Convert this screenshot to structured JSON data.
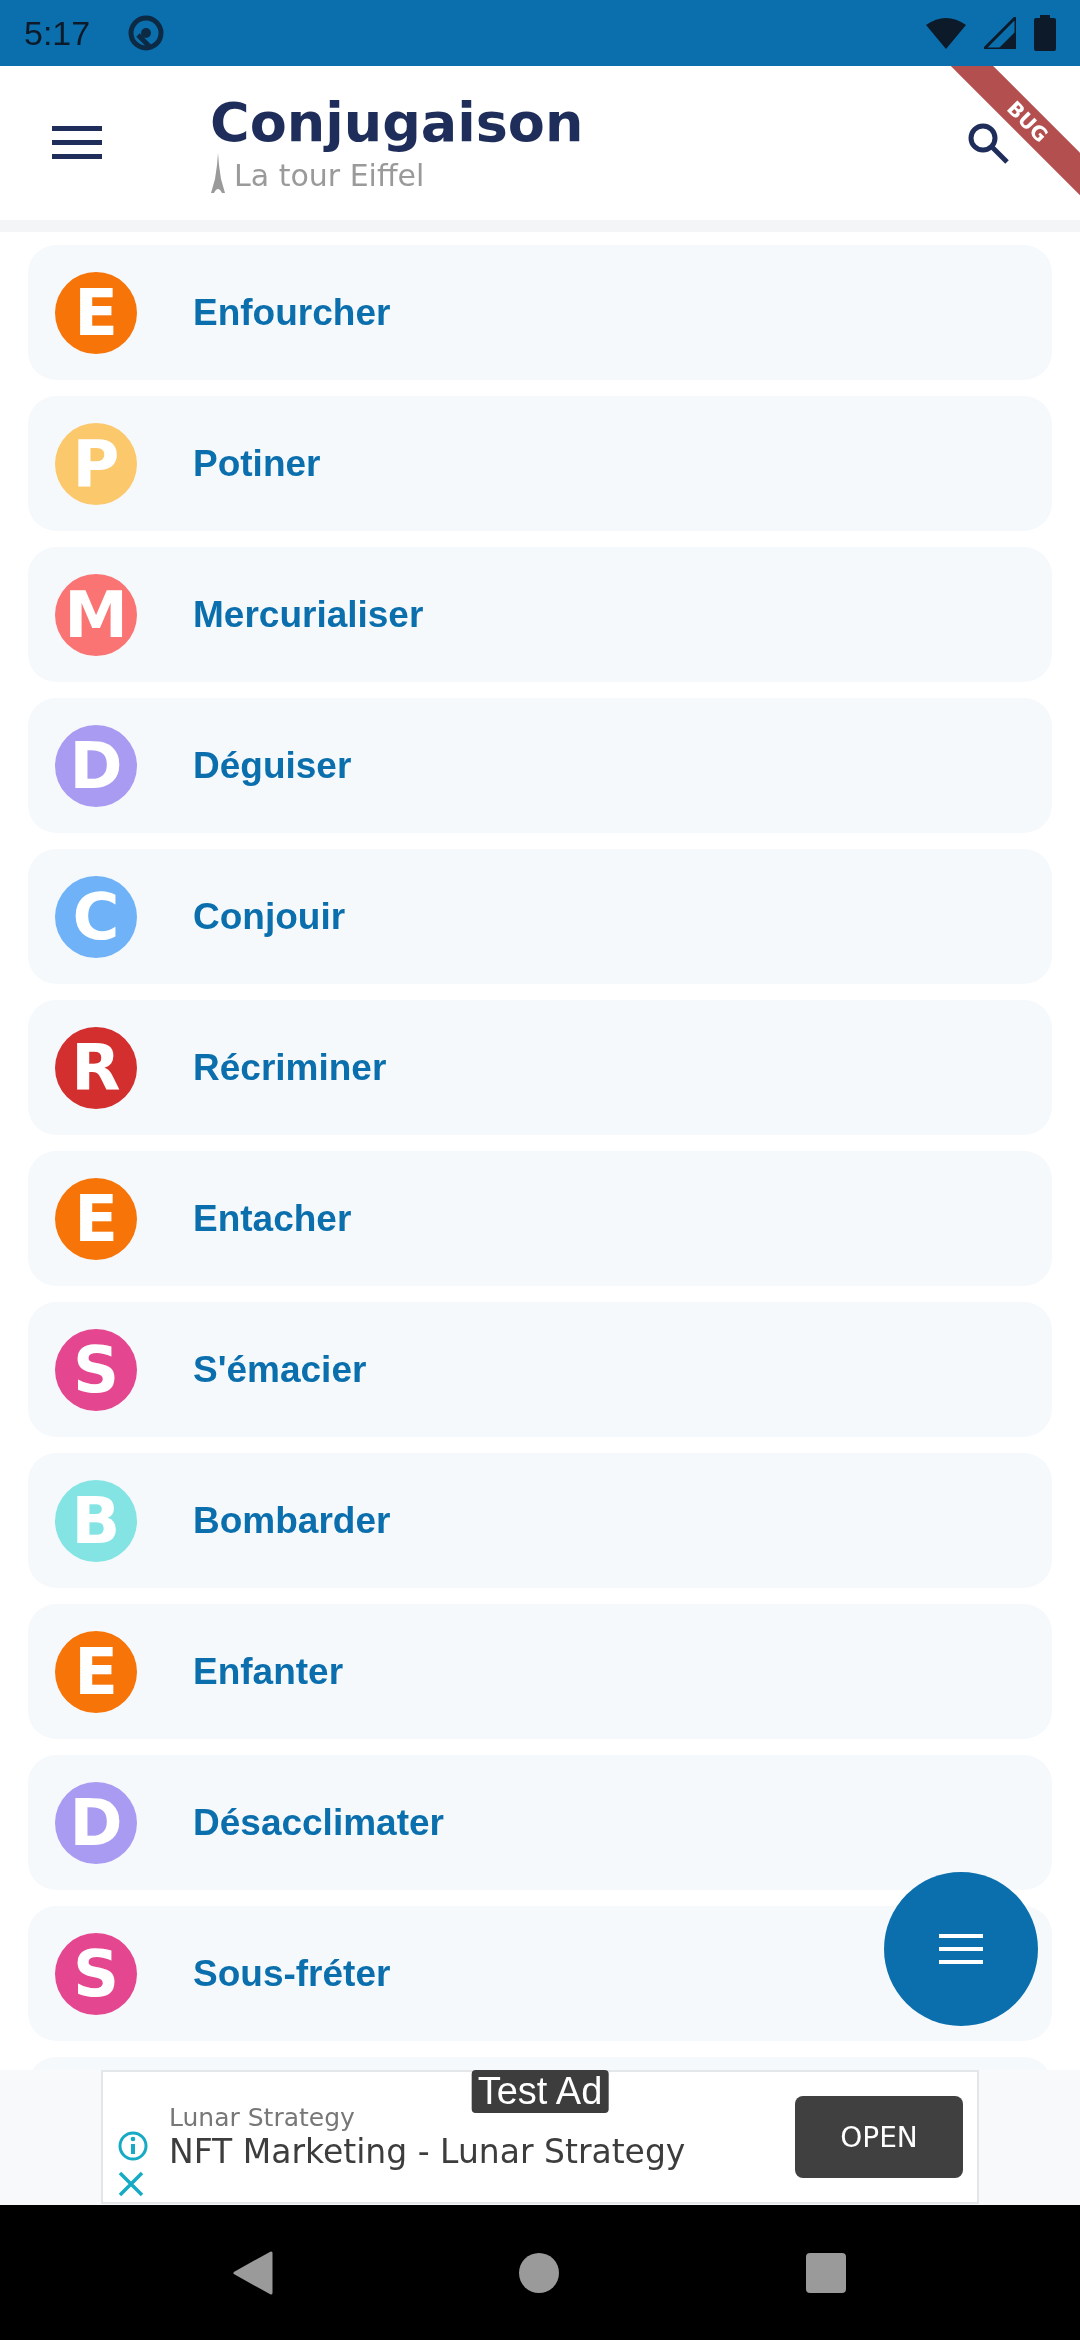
{
  "status_bar": {
    "time": "5:17"
  },
  "app_bar": {
    "title": "Conjugaison",
    "subtitle": "La tour Eiffel",
    "debug_banner": "BUG"
  },
  "verbs": [
    {
      "letter": "E",
      "name": "Enfourcher",
      "color": "#f77408"
    },
    {
      "letter": "P",
      "name": "Potiner",
      "color": "#fbc86c"
    },
    {
      "letter": "M",
      "name": "Mercurialiser",
      "color": "#fa7474"
    },
    {
      "letter": "D",
      "name": "Déguiser",
      "color": "#a99af2"
    },
    {
      "letter": "C",
      "name": "Conjouir",
      "color": "#6fb2f7"
    },
    {
      "letter": "R",
      "name": "Récriminer",
      "color": "#d32f2f"
    },
    {
      "letter": "E",
      "name": "Entacher",
      "color": "#f77408"
    },
    {
      "letter": "S",
      "name": "S'émacier",
      "color": "#e4478f"
    },
    {
      "letter": "B",
      "name": "Bombarder",
      "color": "#84e3e3"
    },
    {
      "letter": "E",
      "name": "Enfanter",
      "color": "#f77408"
    },
    {
      "letter": "D",
      "name": "Désacclimater",
      "color": "#a99af2"
    },
    {
      "letter": "S",
      "name": "Sous-fréter",
      "color": "#e4478f"
    }
  ],
  "ad": {
    "badge": "Test Ad",
    "advertiser": "Lunar Strategy",
    "headline": "NFT Marketing - Lunar Strategy",
    "button": "OPEN"
  }
}
